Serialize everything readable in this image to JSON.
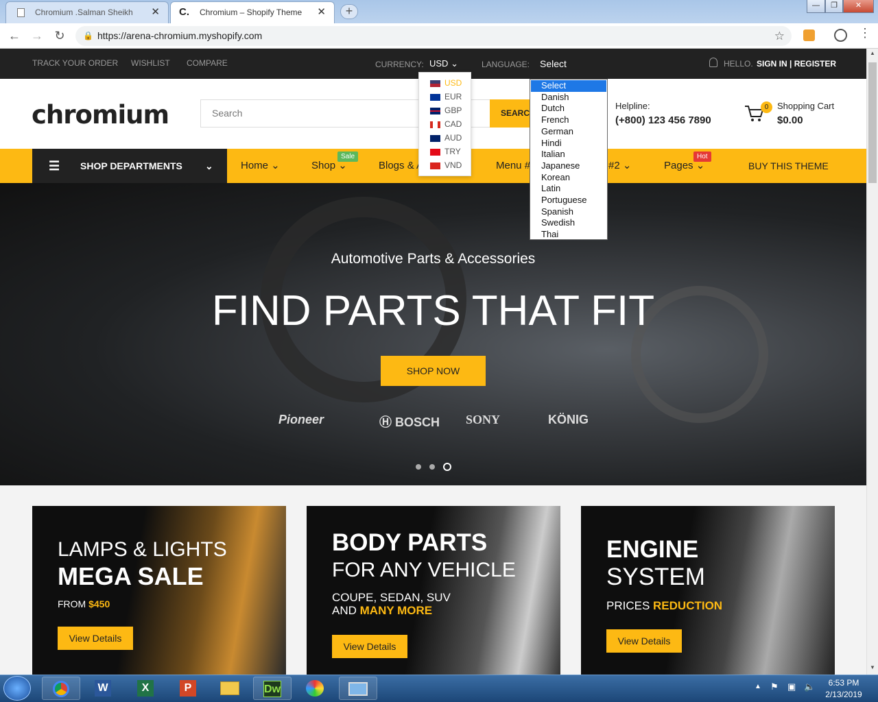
{
  "browser": {
    "tabs": [
      {
        "label": "Chromium .Salman Sheikh",
        "active": false
      },
      {
        "label": "Chromium – Shopify Theme",
        "active": true
      }
    ],
    "url": "https://arena-chromium.myshopify.com"
  },
  "topbar": {
    "links": [
      "TRACK YOUR ORDER",
      "WISHLIST",
      "COMPARE"
    ],
    "currency_label": "CURRENCY:",
    "currency_value": "USD",
    "language_label": "LANGUAGE:",
    "language_value": "Select",
    "hello": "HELLO.",
    "signin": "SIGN IN | REGISTER"
  },
  "currency_options": [
    {
      "code": "USD",
      "flag_colors": [
        "#b22234",
        "#3c3b6e"
      ],
      "selected": true
    },
    {
      "code": "EUR",
      "flag_colors": [
        "#003399",
        "#ffcc00"
      ]
    },
    {
      "code": "GBP",
      "flag_colors": [
        "#012169",
        "#c8102e"
      ]
    },
    {
      "code": "CAD",
      "flag_colors": [
        "#d52b1e",
        "#ffffff"
      ]
    },
    {
      "code": "AUD",
      "flag_colors": [
        "#012169",
        "#e4002b"
      ]
    },
    {
      "code": "TRY",
      "flag_colors": [
        "#e30a17",
        "#ffffff"
      ]
    },
    {
      "code": "VND",
      "flag_colors": [
        "#da251d",
        "#ffff00"
      ]
    }
  ],
  "language_options": [
    "Select",
    "Danish",
    "Dutch",
    "French",
    "German",
    "Hindi",
    "Italian",
    "Japanese",
    "Korean",
    "Latin",
    "Portuguese",
    "Spanish",
    "Swedish",
    "Thai"
  ],
  "header": {
    "logo": "chromium",
    "search_placeholder": "Search",
    "search_button": "SEARCH",
    "helpline_label": "Helpline:",
    "helpline_number": "(+800) 123 456 7890",
    "cart_count": "0",
    "cart_label": "Shopping Cart",
    "cart_total": "$0.00"
  },
  "nav": {
    "departments": "SHOP DEPARTMENTS",
    "items": [
      {
        "label": "Home"
      },
      {
        "label": "Shop",
        "badge": "Sale",
        "badge_color": "#5cb85c"
      },
      {
        "label": "Blogs & A"
      },
      {
        "label": "Menu #"
      },
      {
        "label": "#2"
      },
      {
        "label": "Pages",
        "badge": "Hot",
        "badge_color": "#e53935"
      }
    ],
    "buy_theme": "BUY THIS THEME"
  },
  "hero": {
    "subtitle": "Automotive Parts & Accessories",
    "title": "FIND PARTS THAT FIT",
    "button": "SHOP NOW",
    "brands": [
      "Pioneer",
      "BOSCH",
      "SONY",
      "KÖNIG"
    ],
    "slides": 3,
    "active_slide": 3
  },
  "banners": [
    {
      "line1": "LAMPS & LIGHTS",
      "line2": "MEGA SALE",
      "sub_prefix": "FROM ",
      "sub_highlight": "$450",
      "button": "View Details"
    },
    {
      "line1": "BODY PARTS",
      "line2": "FOR ANY VEHICLE",
      "sub_line1": "COUPE, SEDAN, SUV",
      "sub_prefix": "AND ",
      "sub_highlight": "MANY MORE",
      "button": "View Details"
    },
    {
      "line1": "ENGINE",
      "line2": "SYSTEM",
      "sub_prefix": "PRICES ",
      "sub_highlight": "REDUCTION",
      "button": "View Details"
    }
  ],
  "taskbar": {
    "time": "6:53 PM",
    "date": "2/13/2019"
  },
  "colors": {
    "accent": "#fdb913",
    "dark": "#222222"
  }
}
